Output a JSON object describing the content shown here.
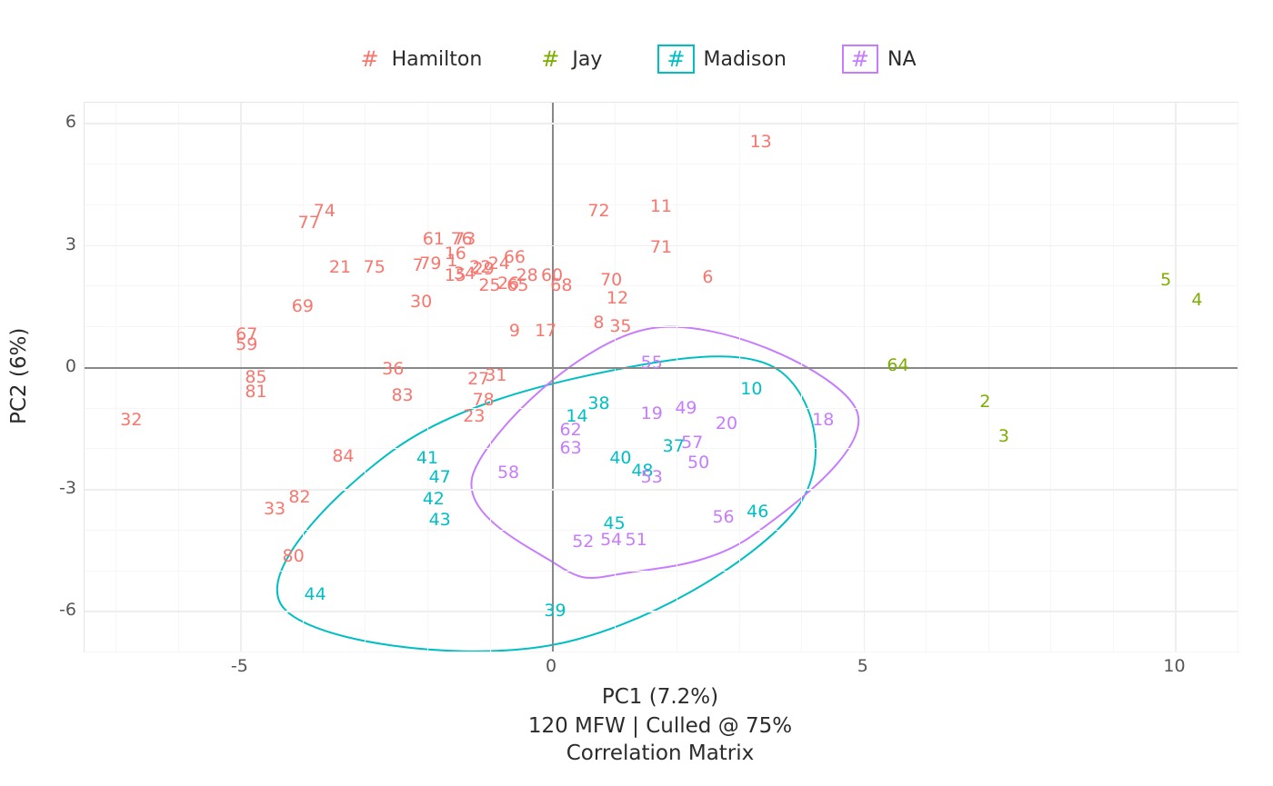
{
  "chart_data": {
    "type": "scatter",
    "xlabel": "PC1 (7.2%)",
    "ylabel": "PC2 (6%)",
    "subtitle1": "120 MFW | Culled @ 75%",
    "subtitle2": "Correlation Matrix",
    "xlim": [
      -7.5,
      11
    ],
    "ylim": [
      -7,
      6.5
    ],
    "x_ticks": [
      -5,
      0,
      5,
      10
    ],
    "y_ticks": [
      -6,
      -3,
      0,
      3,
      6
    ],
    "legend": [
      "Hamilton",
      "Jay",
      "Madison",
      "NA"
    ],
    "legend_boxed": [
      "Madison",
      "NA"
    ],
    "hull_series": [
      "Madison",
      "NA"
    ],
    "colors": {
      "Hamilton": "#f8766d",
      "Jay": "#7cae00",
      "Madison": "#00bfc4",
      "NA": "#c77cff"
    },
    "series": [
      {
        "name": "Hamilton",
        "points": [
          {
            "label": "1",
            "x": -1.6,
            "y": 2.6
          },
          {
            "label": "6",
            "x": 2.5,
            "y": 2.2
          },
          {
            "label": "7",
            "x": -2.15,
            "y": 2.5
          },
          {
            "label": "8",
            "x": 0.75,
            "y": 1.1
          },
          {
            "label": "9",
            "x": -0.6,
            "y": 0.9
          },
          {
            "label": "11",
            "x": 1.75,
            "y": 3.95
          },
          {
            "label": "12",
            "x": 1.05,
            "y": 1.7
          },
          {
            "label": "13",
            "x": 3.35,
            "y": 5.55
          },
          {
            "label": "15",
            "x": -1.55,
            "y": 2.25
          },
          {
            "label": "16",
            "x": -1.55,
            "y": 2.8
          },
          {
            "label": "17",
            "x": -0.1,
            "y": 0.9
          },
          {
            "label": "21",
            "x": -3.4,
            "y": 2.45
          },
          {
            "label": "22",
            "x": -1.15,
            "y": 2.45
          },
          {
            "label": "23",
            "x": -1.25,
            "y": -1.2
          },
          {
            "label": "24",
            "x": -0.85,
            "y": 2.55
          },
          {
            "label": "25",
            "x": -1.0,
            "y": 2.0
          },
          {
            "label": "26",
            "x": -0.7,
            "y": 2.05
          },
          {
            "label": "27",
            "x": -1.18,
            "y": -0.3
          },
          {
            "label": "28",
            "x": -0.4,
            "y": 2.25
          },
          {
            "label": "29",
            "x": -1.1,
            "y": 2.4
          },
          {
            "label": "30",
            "x": -2.1,
            "y": 1.6
          },
          {
            "label": "31",
            "x": -0.9,
            "y": -0.2
          },
          {
            "label": "32",
            "x": -6.75,
            "y": -1.3
          },
          {
            "label": "33",
            "x": -4.45,
            "y": -3.5
          },
          {
            "label": "34",
            "x": -1.4,
            "y": 2.3
          },
          {
            "label": "35",
            "x": 1.1,
            "y": 1.0
          },
          {
            "label": "36",
            "x": -2.55,
            "y": -0.05
          },
          {
            "label": "59",
            "x": -4.9,
            "y": 0.55
          },
          {
            "label": "60",
            "x": 0.0,
            "y": 2.25
          },
          {
            "label": "61",
            "x": -1.9,
            "y": 3.15
          },
          {
            "label": "65",
            "x": -0.55,
            "y": 2.0
          },
          {
            "label": "66",
            "x": -0.6,
            "y": 2.7
          },
          {
            "label": "67",
            "x": -4.9,
            "y": 0.8
          },
          {
            "label": "68",
            "x": 0.15,
            "y": 2.0
          },
          {
            "label": "69",
            "x": -4.0,
            "y": 1.5
          },
          {
            "label": "70",
            "x": 0.95,
            "y": 2.15
          },
          {
            "label": "71",
            "x": 1.75,
            "y": 2.95
          },
          {
            "label": "72",
            "x": 0.75,
            "y": 3.85
          },
          {
            "label": "73",
            "x": -1.4,
            "y": 3.15
          },
          {
            "label": "74",
            "x": -3.65,
            "y": 3.85
          },
          {
            "label": "75",
            "x": -2.85,
            "y": 2.45
          },
          {
            "label": "76",
            "x": -1.45,
            "y": 3.15
          },
          {
            "label": "77",
            "x": -3.9,
            "y": 3.55
          },
          {
            "label": "78",
            "x": -1.1,
            "y": -0.8
          },
          {
            "label": "79",
            "x": -1.95,
            "y": 2.55
          },
          {
            "label": "80",
            "x": -4.15,
            "y": -4.65
          },
          {
            "label": "81",
            "x": -4.75,
            "y": -0.6
          },
          {
            "label": "82",
            "x": -4.05,
            "y": -3.2
          },
          {
            "label": "83",
            "x": -2.4,
            "y": -0.7
          },
          {
            "label": "84",
            "x": -3.35,
            "y": -2.2
          },
          {
            "label": "85",
            "x": -4.75,
            "y": -0.25
          }
        ]
      },
      {
        "name": "Jay",
        "points": [
          {
            "label": "2",
            "x": 6.95,
            "y": -0.85
          },
          {
            "label": "3",
            "x": 7.25,
            "y": -1.7
          },
          {
            "label": "4",
            "x": 10.35,
            "y": 1.65
          },
          {
            "label": "5",
            "x": 9.85,
            "y": 2.15
          },
          {
            "label": "64",
            "x": 5.55,
            "y": 0.05
          }
        ]
      },
      {
        "name": "Madison",
        "points": [
          {
            "label": "10",
            "x": 3.2,
            "y": -0.55
          },
          {
            "label": "14",
            "x": 0.4,
            "y": -1.2
          },
          {
            "label": "37",
            "x": 1.95,
            "y": -1.95
          },
          {
            "label": "38",
            "x": 0.75,
            "y": -0.9
          },
          {
            "label": "39",
            "x": 0.05,
            "y": -6.0
          },
          {
            "label": "40",
            "x": 1.1,
            "y": -2.25
          },
          {
            "label": "41",
            "x": -2.0,
            "y": -2.25
          },
          {
            "label": "42",
            "x": -1.9,
            "y": -3.25
          },
          {
            "label": "43",
            "x": -1.8,
            "y": -3.75
          },
          {
            "label": "44",
            "x": -3.8,
            "y": -5.6
          },
          {
            "label": "45",
            "x": 1.0,
            "y": -3.85
          },
          {
            "label": "46",
            "x": 3.3,
            "y": -3.55
          },
          {
            "label": "47",
            "x": -1.8,
            "y": -2.7
          },
          {
            "label": "48",
            "x": 1.45,
            "y": -2.55
          }
        ]
      },
      {
        "name": "NA",
        "points": [
          {
            "label": "18",
            "x": 4.35,
            "y": -1.3
          },
          {
            "label": "19",
            "x": 1.6,
            "y": -1.15
          },
          {
            "label": "20",
            "x": 2.8,
            "y": -1.4
          },
          {
            "label": "49",
            "x": 2.15,
            "y": -1.0
          },
          {
            "label": "50",
            "x": 2.35,
            "y": -2.35
          },
          {
            "label": "51",
            "x": 1.35,
            "y": -4.25
          },
          {
            "label": "52",
            "x": 0.5,
            "y": -4.3
          },
          {
            "label": "53",
            "x": 1.6,
            "y": -2.7
          },
          {
            "label": "54",
            "x": 0.95,
            "y": -4.25
          },
          {
            "label": "55",
            "x": 1.6,
            "y": 0.1
          },
          {
            "label": "56",
            "x": 2.75,
            "y": -3.7
          },
          {
            "label": "57",
            "x": 2.25,
            "y": -1.85
          },
          {
            "label": "58",
            "x": -0.7,
            "y": -2.6
          },
          {
            "label": "62",
            "x": 0.3,
            "y": -1.55
          },
          {
            "label": "63",
            "x": 0.3,
            "y": -2.0
          }
        ]
      }
    ]
  }
}
